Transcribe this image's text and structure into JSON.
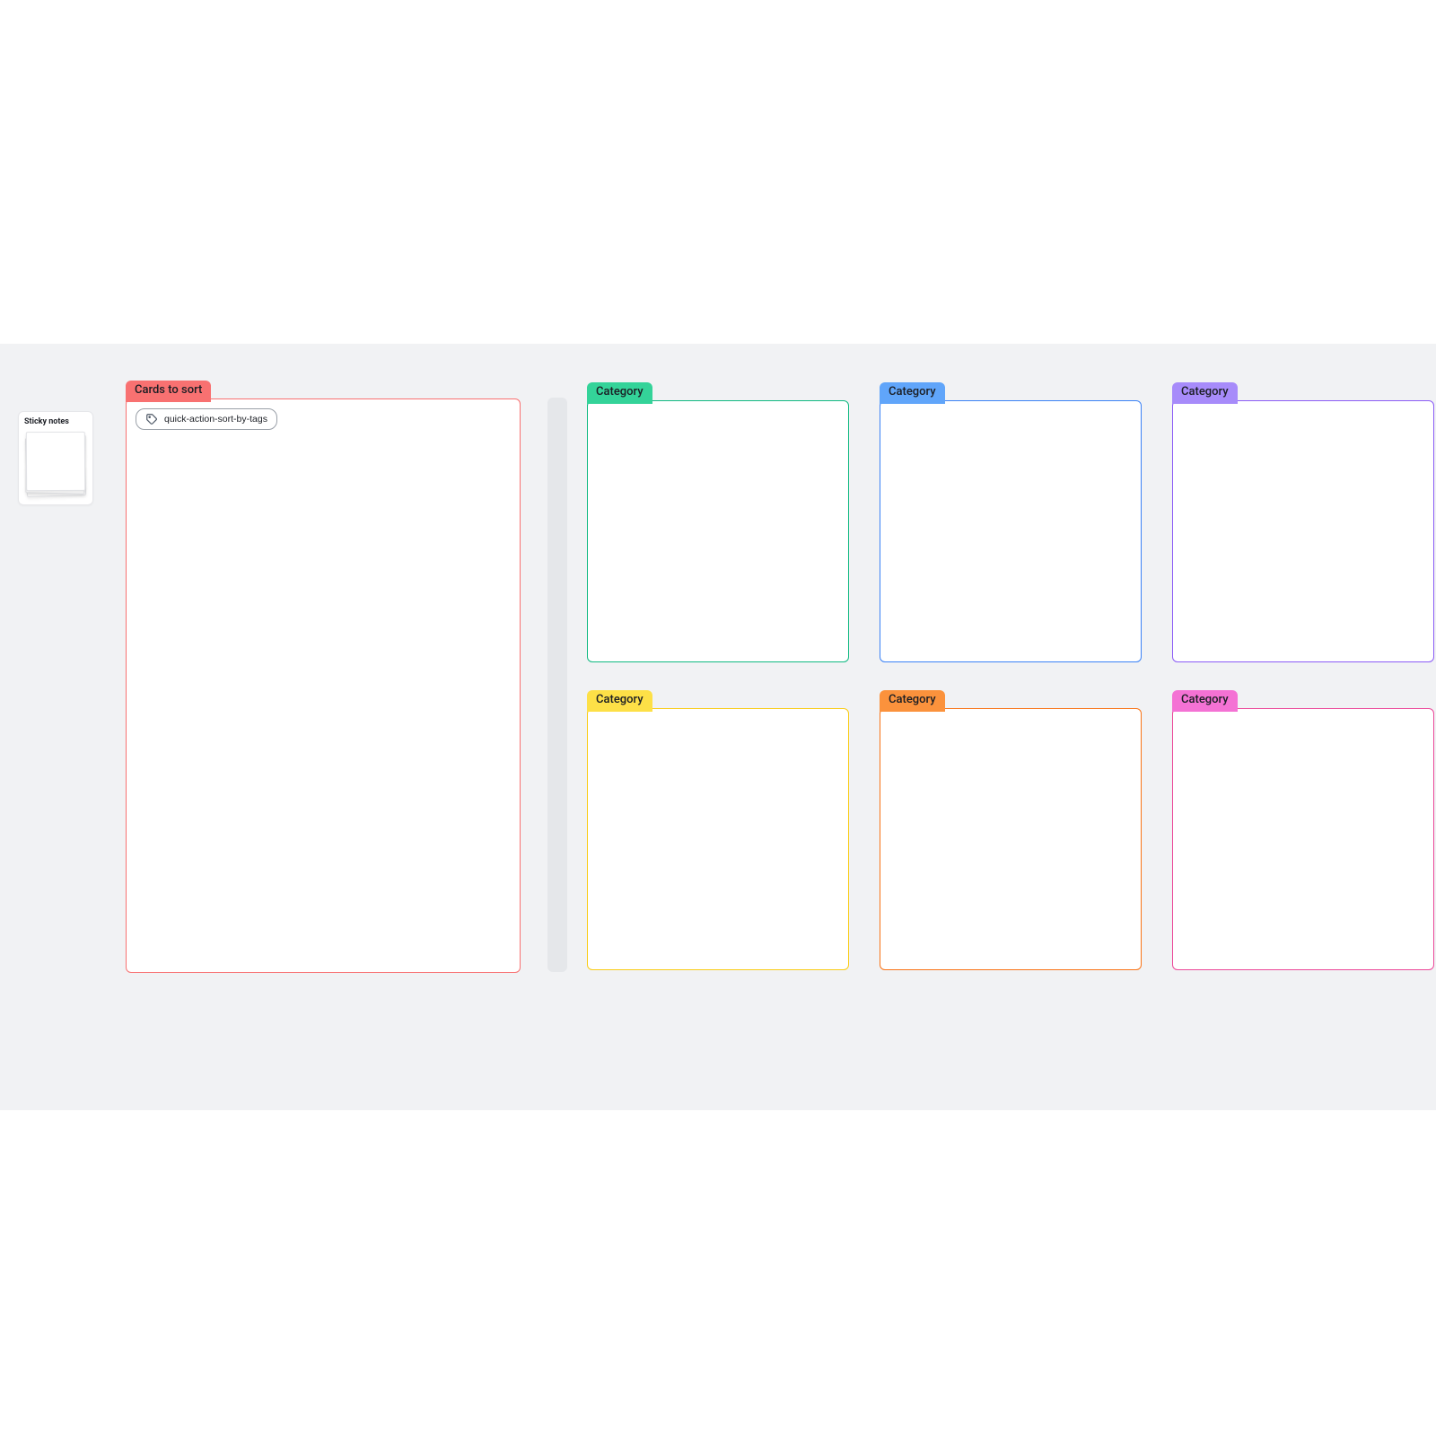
{
  "palette": {
    "title": "Sticky notes"
  },
  "sort_column": {
    "label": "Cards to sort",
    "quick_action": {
      "text": "quick-action-sort-by-tags"
    }
  },
  "categories": [
    {
      "label": "Category",
      "color": "green"
    },
    {
      "label": "Category",
      "color": "blue"
    },
    {
      "label": "Category",
      "color": "purple"
    },
    {
      "label": "Category",
      "color": "yellow"
    },
    {
      "label": "Category",
      "color": "orange"
    },
    {
      "label": "Category",
      "color": "magenta"
    }
  ]
}
